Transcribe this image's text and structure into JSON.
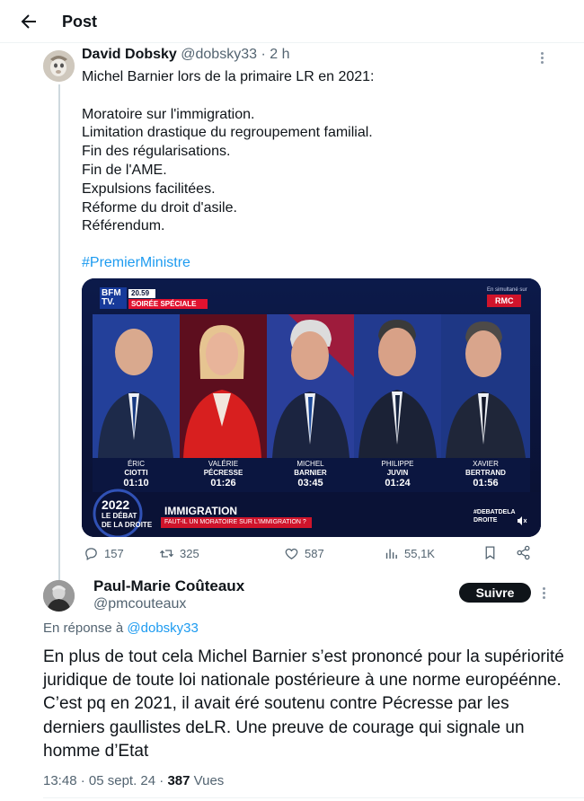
{
  "header": {
    "title": "Post"
  },
  "post1": {
    "author_name": "David Dobsky",
    "handle": "@dobsky33",
    "separator": "·",
    "time": "2 h",
    "text": "Michel Barnier lors de la primaire LR en 2021:\n\nMoratoire sur l'immigration.\nLimitation drastique du regroupement familial.\nFin des régularisations.\nFin de l'AME.\nExpulsions facilitées.\nRéforme du droit d'asile.\nRéférendum.",
    "hashtag": "#PremierMinistre",
    "media": {
      "channel_logo": "BFM TV.",
      "clock": "20.59",
      "banner": "SOIRÉE SPÉCIALE",
      "simulcast_label": "En simultané sur",
      "simulcast_logo": "RMC",
      "event_year": "2022",
      "event_title_1": "LE DÉBAT",
      "event_title_2": "DE LA DROITE",
      "topic": "IMMIGRATION",
      "topic_sub": "FAUT-IL UN MORATOIRE SUR L'IMMIGRATION ?",
      "hashtag_overlay": "#DEBATDELA DROITE",
      "candidates": [
        {
          "first": "ÉRIC",
          "last": "CIOTTI",
          "time": "01:10"
        },
        {
          "first": "VALÉRIE",
          "last": "PÉCRESSE",
          "time": "01:26"
        },
        {
          "first": "MICHEL",
          "last": "BARNIER",
          "time": "03:45"
        },
        {
          "first": "PHILIPPE",
          "last": "JUVIN",
          "time": "01:24"
        },
        {
          "first": "XAVIER",
          "last": "BERTRAND",
          "time": "01:56"
        }
      ]
    },
    "stats": {
      "replies": "157",
      "reposts": "325",
      "likes": "587",
      "views": "55,1K"
    }
  },
  "post2": {
    "author_name": "Paul-Marie Coûteaux",
    "handle": "@pmcouteaux",
    "follow_label": "Suivre",
    "reply_prefix": "En réponse à",
    "reply_handle": "@dobsky33",
    "text": "En plus de tout cela Michel Barnier s’est prononcé pour la supériorité juridique de  toute loi nationale postérieure à une norme européénne. C’est pq en 2021, il avait éré soutenu contre Pécresse par les  derniers gaullistes deLR. Une preuve de courage qui signale un homme d’Etat",
    "time": "13:48",
    "separator": "·",
    "date": "05 sept. 24",
    "views_count": "387",
    "views_label": "Vues"
  },
  "colors": {
    "accent": "#1d9bf0",
    "text": "#0f1419",
    "muted": "#536471",
    "follow_bg": "#0f1419"
  }
}
